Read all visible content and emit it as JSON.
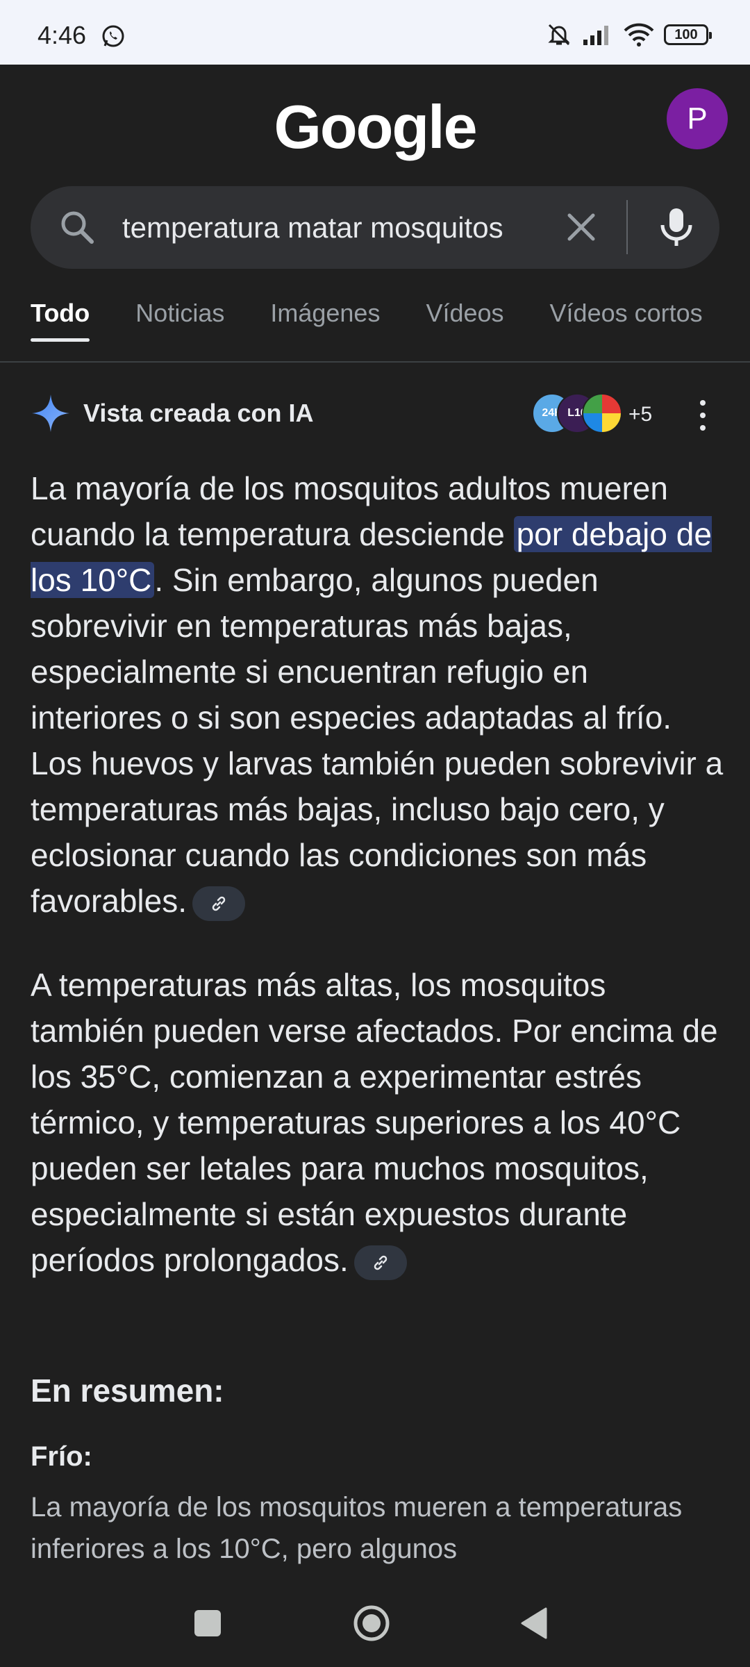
{
  "status_bar": {
    "time": "4:46",
    "battery": "100",
    "icons": [
      "whatsapp-icon",
      "mute-icon",
      "signal-icon",
      "wifi-icon",
      "battery-icon"
    ]
  },
  "header": {
    "logo": "Google",
    "avatar_letter": "P",
    "avatar_color": "#7b1fa2"
  },
  "search": {
    "query": "temperatura matar mosquitos"
  },
  "tabs": [
    {
      "label": "Todo",
      "active": true
    },
    {
      "label": "Noticias",
      "active": false
    },
    {
      "label": "Imágenes",
      "active": false
    },
    {
      "label": "Vídeos",
      "active": false
    },
    {
      "label": "Vídeos cortos",
      "active": false
    }
  ],
  "ai_overview": {
    "title": "Vista creada con IA",
    "sources": [
      "24H",
      "L10",
      ""
    ],
    "more_sources": "+5",
    "paragraph1": {
      "before": "La mayoría de los mosquitos adultos mueren cuando la temperatura desciende ",
      "highlight": "por debajo de los 10°C",
      "after": ". Sin embargo, algunos pueden sobrevivir en temperaturas más bajas, especialmente si encuentran refugio en interiores o si son especies adaptadas al frío. Los huevos y larvas también pueden sobrevivir a temperaturas más bajas, incluso bajo cero, y eclosionar cuando las condiciones son más favorables."
    },
    "paragraph2": "A temperaturas más altas, los mosquitos también pueden verse afectados. Por encima de los 35°C, comienzan a experimentar estrés térmico, y temperaturas superiores a los 40°C pueden ser letales para muchos mosquitos, especialmente si están expuestos durante períodos prolongados.",
    "summary_heading": "En resumen:",
    "cold_label": "Frío:",
    "cold_text": "La mayoría de los mosquitos mueren a temperaturas inferiores a los 10°C, pero algunos"
  },
  "colors": {
    "background": "#1f1f1f",
    "search_bg": "#303134",
    "highlight": "#2e3d6e"
  }
}
